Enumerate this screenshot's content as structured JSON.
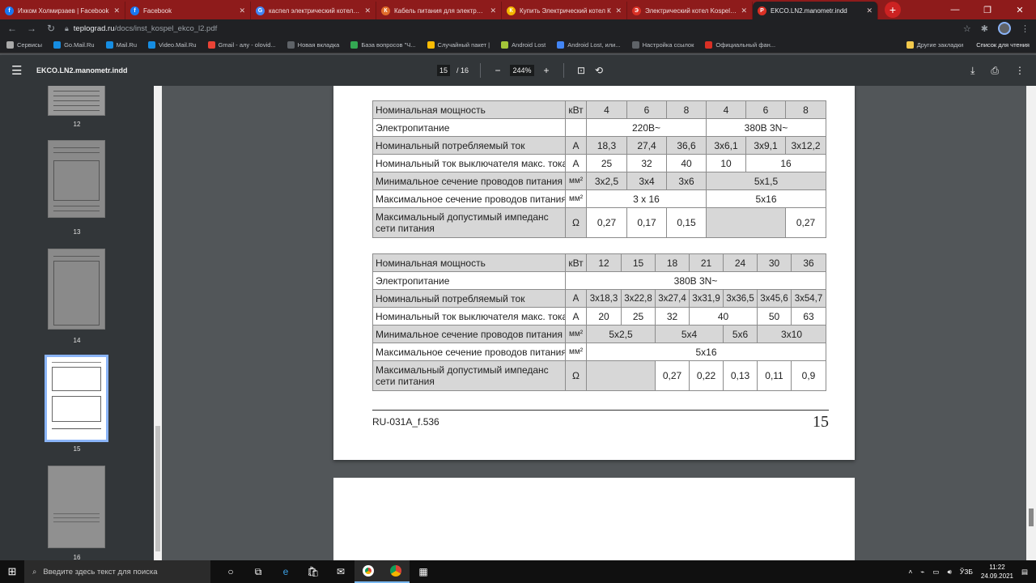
{
  "browser": {
    "tabs": [
      {
        "title": "Ихком Холмирзаев | Facebook",
        "favicon_color": "#1877f2",
        "favicon": "f",
        "active": false
      },
      {
        "title": "Facebook",
        "favicon_color": "#1877f2",
        "favicon": "f",
        "active": false
      },
      {
        "title": "каспел электрический котел 3(",
        "favicon_color": "#4285f4",
        "favicon": "G",
        "active": false
      },
      {
        "title": "Кабель питания для электриче",
        "favicon_color": "#e06c2a",
        "favicon": "К",
        "active": false
      },
      {
        "title": "Купить Электрический котел К",
        "favicon_color": "#f4b400",
        "favicon": "К",
        "active": false
      },
      {
        "title": "Электрический котел Kospel EI",
        "favicon_color": "#d93025",
        "favicon": "Э",
        "active": false
      },
      {
        "title": "EKCO.LN2.manometr.indd",
        "favicon_color": "#d93025",
        "favicon": "P",
        "active": true
      }
    ],
    "new_tab_symbol": "+",
    "url_host": "teplograd.ru",
    "url_path": "/docs/inst_kospel_ekco_l2.pdf",
    "bookmarks": [
      {
        "label": "Сервисы",
        "color": "#aaaaaa"
      },
      {
        "label": "Go.Mail.Ru",
        "color": "#168de2"
      },
      {
        "label": "Mail.Ru",
        "color": "#168de2"
      },
      {
        "label": "Video.Mail.Ru",
        "color": "#168de2"
      },
      {
        "label": "Gmail - алу - olovid...",
        "color": "#ea4335"
      },
      {
        "label": "Новая вкладка",
        "color": "#5f6368"
      },
      {
        "label": "База вопросов \"Ч...",
        "color": "#34a853"
      },
      {
        "label": "Случайный пакет |",
        "color": "#fbbc04"
      },
      {
        "label": "Android Lost",
        "color": "#a4c639"
      },
      {
        "label": "Android Lost, или...",
        "color": "#4285f4"
      },
      {
        "label": "Настройка ссылок",
        "color": "#5f6368"
      },
      {
        "label": "Официальный фан...",
        "color": "#d93025"
      }
    ],
    "bookmarks_other": "Другие закладки",
    "reading_list": "Список для чтения"
  },
  "pdf": {
    "title": "EKCO.LN2.manometr.indd",
    "current_page": "15",
    "total_pages": "/ 16",
    "zoom": "244%",
    "thumbnails": [
      {
        "label": "12"
      },
      {
        "label": "13"
      },
      {
        "label": "14"
      },
      {
        "label": "15"
      },
      {
        "label": "16"
      }
    ]
  },
  "table1": {
    "r1": {
      "label": "Номинальная мощность",
      "unit": "кВт",
      "v": [
        "4",
        "6",
        "8",
        "4",
        "6",
        "8"
      ]
    },
    "r2": {
      "label": "Электропитание",
      "a": "220В~",
      "b": "380В 3N~"
    },
    "r3": {
      "label": "Номинальный потребляемый ток",
      "unit": "А",
      "v": [
        "18,3",
        "27,4",
        "36,6",
        "3x6,1",
        "3x9,1",
        "3x12,2"
      ]
    },
    "r4": {
      "label": "Номинальный ток выключателя макс. тока",
      "unit": "А",
      "v": [
        "25",
        "32",
        "40",
        "10",
        "16"
      ]
    },
    "r5": {
      "label": "Минимальное сечение проводов питания",
      "unit": "мм²",
      "v": [
        "3x2,5",
        "3x4",
        "3x6",
        "5x1,5"
      ]
    },
    "r6": {
      "label": "Максимальное сечение проводов питания",
      "unit": "мм²",
      "v": [
        "3 x 16",
        "5x16"
      ]
    },
    "r7": {
      "label1": "Максимальный допустимый импеданс",
      "label2": "сети питания",
      "unit": "Ω",
      "v": [
        "0,27",
        "0,17",
        "0,15",
        "0,27"
      ]
    }
  },
  "table2": {
    "r1": {
      "label": "Номинальная мощность",
      "unit": "кВт",
      "v": [
        "12",
        "15",
        "18",
        "21",
        "24",
        "30",
        "36"
      ]
    },
    "r2": {
      "label": "Электропитание",
      "a": "380В 3N~"
    },
    "r3": {
      "label": "Номинальный потребляемый ток",
      "unit": "А",
      "v": [
        "3x18,3",
        "3x22,8",
        "3x27,4",
        "3x31,9",
        "3x36,5",
        "3x45,6",
        "3x54,7"
      ]
    },
    "r4": {
      "label": "Номинальный ток выключателя макс. тока",
      "unit": "А",
      "v": [
        "20",
        "25",
        "32",
        "40",
        "50",
        "63"
      ]
    },
    "r5": {
      "label": "Минимальное сечение проводов питания",
      "unit": "мм²",
      "v": [
        "5x2,5",
        "5x4",
        "5x6",
        "3x10"
      ]
    },
    "r6": {
      "label": "Максимальное сечение проводов питания",
      "unit": "мм²",
      "v": [
        "5x16"
      ]
    },
    "r7": {
      "label1": "Максимальный допустимый импеданс",
      "label2": "сети питания",
      "unit": "Ω",
      "v": [
        "0,27",
        "0,22",
        "0,13",
        "0,11",
        "0,9"
      ]
    }
  },
  "footer": {
    "code": "RU-031A_f.536",
    "page_number": "15"
  },
  "taskbar": {
    "search_placeholder": "Введите здесь текст для поиска",
    "lang": "ЎЗБ",
    "time": "11:22",
    "date": "24.09.2021"
  }
}
